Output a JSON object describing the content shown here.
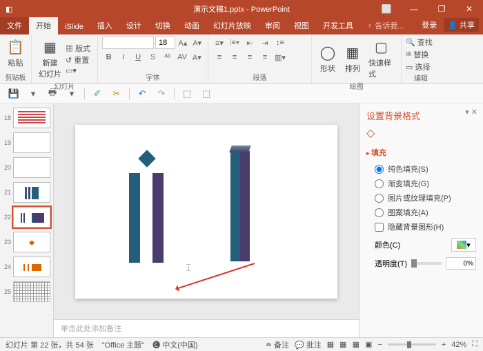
{
  "title": "演示文稿1.pptx - PowerPoint",
  "titlebar": {
    "pin": "⬜",
    "min": "—",
    "max": "❐",
    "close": "✕"
  },
  "tabs": {
    "file": "文件",
    "home": "开始",
    "islide": "iSlide",
    "insert": "插入",
    "design": "设计",
    "transitions": "切换",
    "animations": "动画",
    "slideshow": "幻灯片放映",
    "review": "审阅",
    "view": "视图",
    "dev": "开发工具",
    "tell": "告诉我...",
    "signin": "登录",
    "share": "共享"
  },
  "ribbon": {
    "clipboard": {
      "paste": "粘贴",
      "label": "剪贴板"
    },
    "slides": {
      "new": "新建\n幻灯片",
      "layout": "版式",
      "reset": "重置",
      "label": "幻灯片"
    },
    "font": {
      "family": "",
      "size": "18",
      "label": "字体"
    },
    "para": {
      "label": "段落"
    },
    "drawing": {
      "shapes": "形状",
      "arrange": "排列",
      "quick": "快速样式",
      "label": "绘图"
    },
    "editing": {
      "find": "查找",
      "replace": "替换",
      "select": "选择",
      "label": "编辑"
    }
  },
  "pane": {
    "title": "设置背景格式",
    "fill": "填充",
    "solid": "纯色填充(S)",
    "gradient": "渐变填充(G)",
    "picture": "图片或纹理填充(P)",
    "pattern": "图案填充(A)",
    "hide": "隐藏背景图形(H)",
    "color": "颜色(C)",
    "trans": "透明度(T)",
    "transval": "0%"
  },
  "thumbs": [
    {
      "n": "18"
    },
    {
      "n": "19"
    },
    {
      "n": "20"
    },
    {
      "n": "21"
    },
    {
      "n": "22",
      "sel": true
    },
    {
      "n": "23",
      "star": true
    },
    {
      "n": "24",
      "star": true
    },
    {
      "n": "25",
      "star": true
    }
  ],
  "notes": "单击此处添加备注",
  "status": {
    "slide": "幻灯片 第 22 张，共 54 张",
    "theme": "\"Office 主题\"",
    "lang": "中文(中国)",
    "notes": "备注",
    "comments": "批注",
    "zoom": "42%"
  }
}
